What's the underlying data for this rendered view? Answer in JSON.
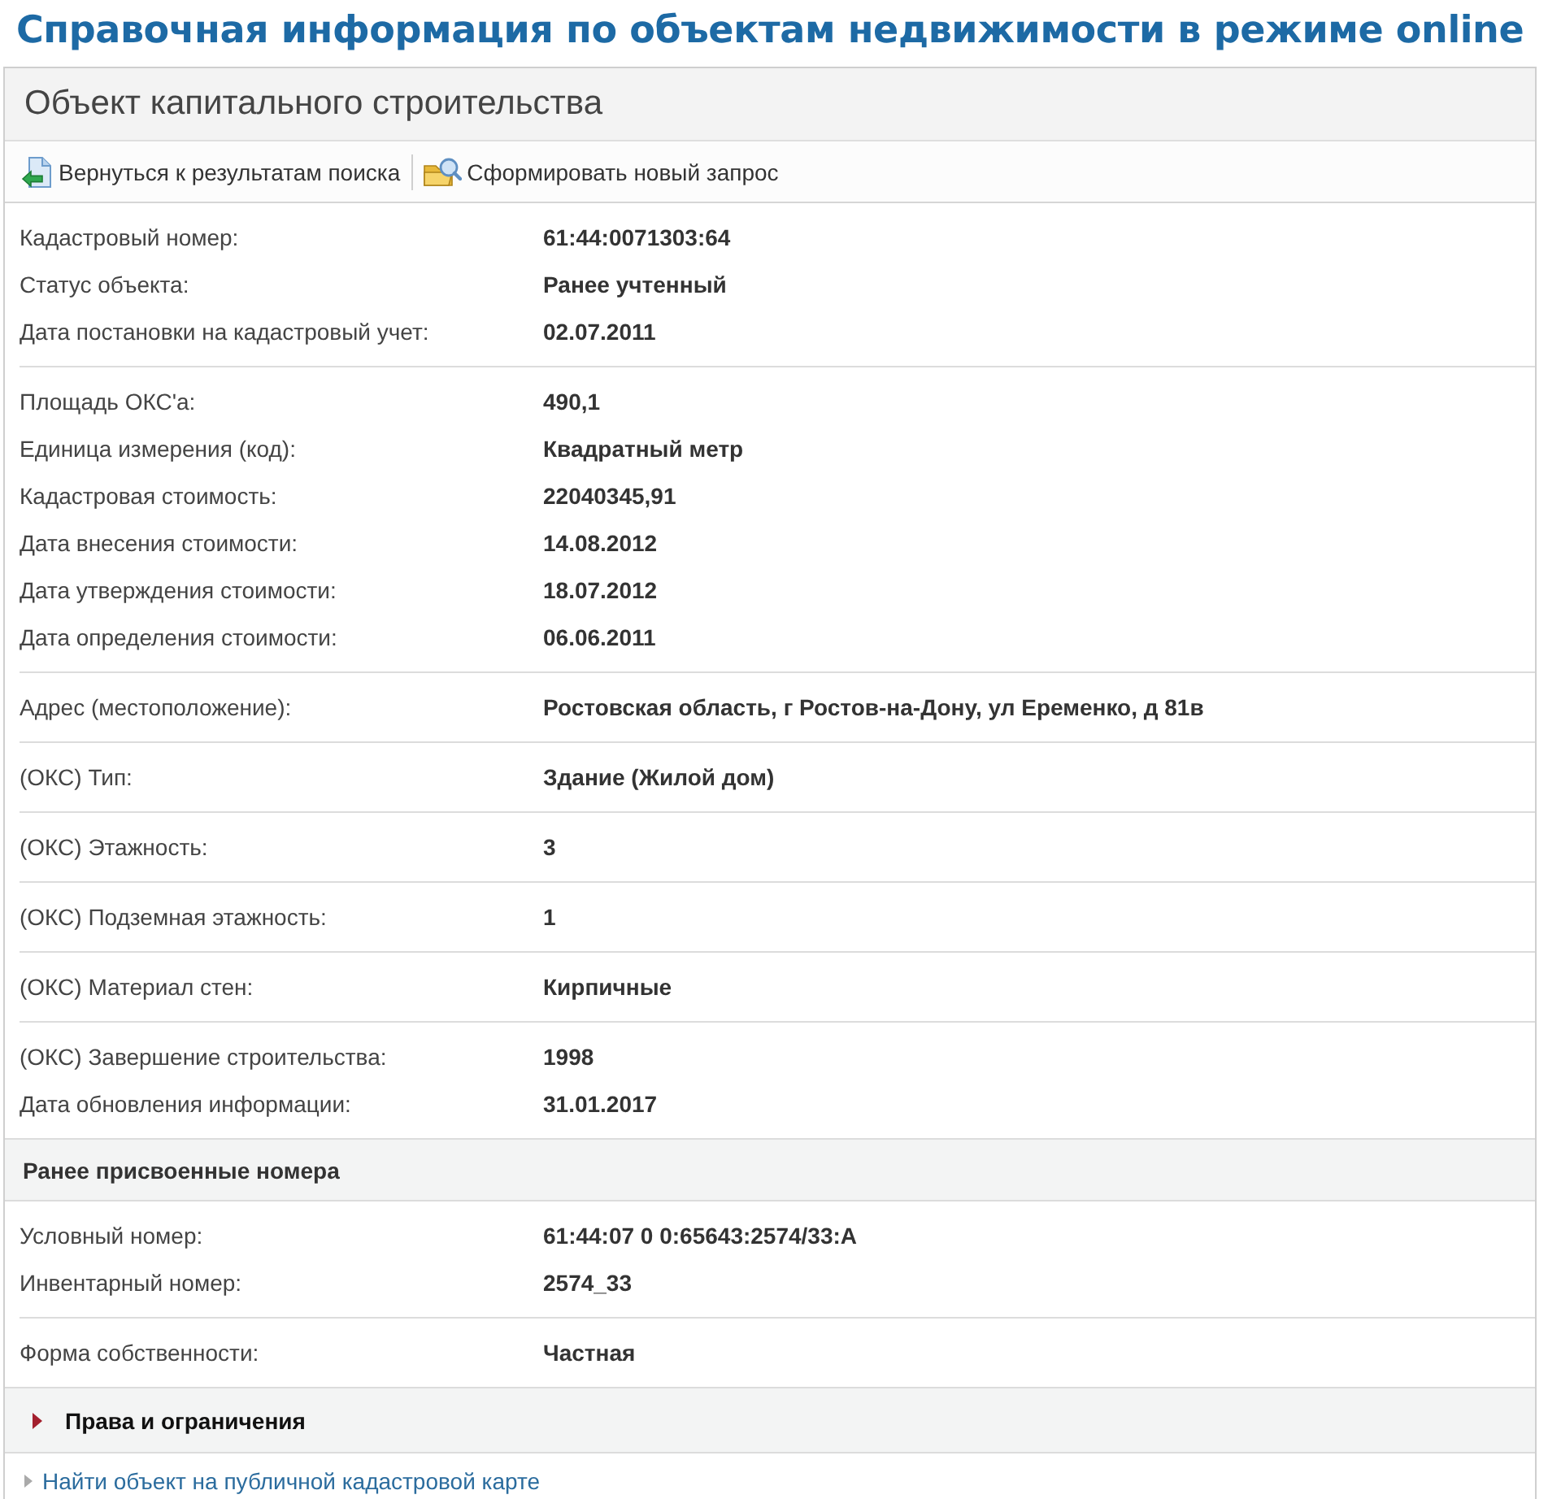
{
  "heading": "Справочная информация по объектам недвижимости в режиме online",
  "panel": {
    "title": "Объект капитального строительства"
  },
  "toolbar": [
    {
      "kind": "back",
      "label": "Вернуться к результатам поиска"
    },
    {
      "kind": "new_query",
      "label": "Сформировать новый запрос"
    }
  ],
  "blocks": [
    {
      "kind": "rows",
      "rows": [
        {
          "label": "Кадастровый номер:",
          "value": "61:44:0071303:64"
        },
        {
          "label": "Статус объекта:",
          "value": "Ранее учтенный"
        },
        {
          "label": "Дата постановки на кадастровый учет:",
          "value": "02.07.2011"
        }
      ]
    },
    {
      "kind": "rows",
      "rows": [
        {
          "label": "Площадь ОКС'а:",
          "value": "490,1"
        },
        {
          "label": "Единица измерения (код):",
          "value": "Квадратный метр"
        },
        {
          "label": "Кадастровая стоимость:",
          "value": "22040345,91"
        },
        {
          "label": "Дата внесения стоимости:",
          "value": "14.08.2012"
        },
        {
          "label": "Дата утверждения стоимости:",
          "value": "18.07.2012"
        },
        {
          "label": "Дата определения стоимости:",
          "value": "06.06.2011"
        }
      ]
    },
    {
      "kind": "rows",
      "rows": [
        {
          "label": "Адрес (местоположение):",
          "value": "Ростовская область, г Ростов-на-Дону, ул Еременко, д 81в"
        }
      ]
    },
    {
      "kind": "rows",
      "rows": [
        {
          "label": "(ОКС) Тип:",
          "value": "Здание (Жилой дом)"
        }
      ]
    },
    {
      "kind": "rows",
      "rows": [
        {
          "label": "(ОКС) Этажность:",
          "value": "3"
        }
      ]
    },
    {
      "kind": "rows",
      "rows": [
        {
          "label": "(ОКС) Подземная этажность:",
          "value": "1"
        }
      ]
    },
    {
      "kind": "rows",
      "rows": [
        {
          "label": "(ОКС) Материал стен:",
          "value": "Кирпичные"
        }
      ]
    },
    {
      "kind": "rows",
      "rows": [
        {
          "label": "(ОКС) Завершение строительства:",
          "value": "1998"
        },
        {
          "label": "Дата обновления информации:",
          "value": "31.01.2017"
        }
      ]
    },
    {
      "kind": "section",
      "title": "Ранее присвоенные номера"
    },
    {
      "kind": "rows",
      "rows": [
        {
          "label": "Условный номер:",
          "value": "61:44:07 0 0:65643:2574/33:A"
        },
        {
          "label": "Инвентарный номер:",
          "value": "2574_33"
        }
      ]
    },
    {
      "kind": "rows",
      "rows": [
        {
          "label": "Форма собственности:",
          "value": "Частная"
        }
      ]
    },
    {
      "kind": "expander",
      "title": "Права и ограничения",
      "expanded": false
    }
  ],
  "footer_link": "Найти объект на публичной кадастровой карте"
}
